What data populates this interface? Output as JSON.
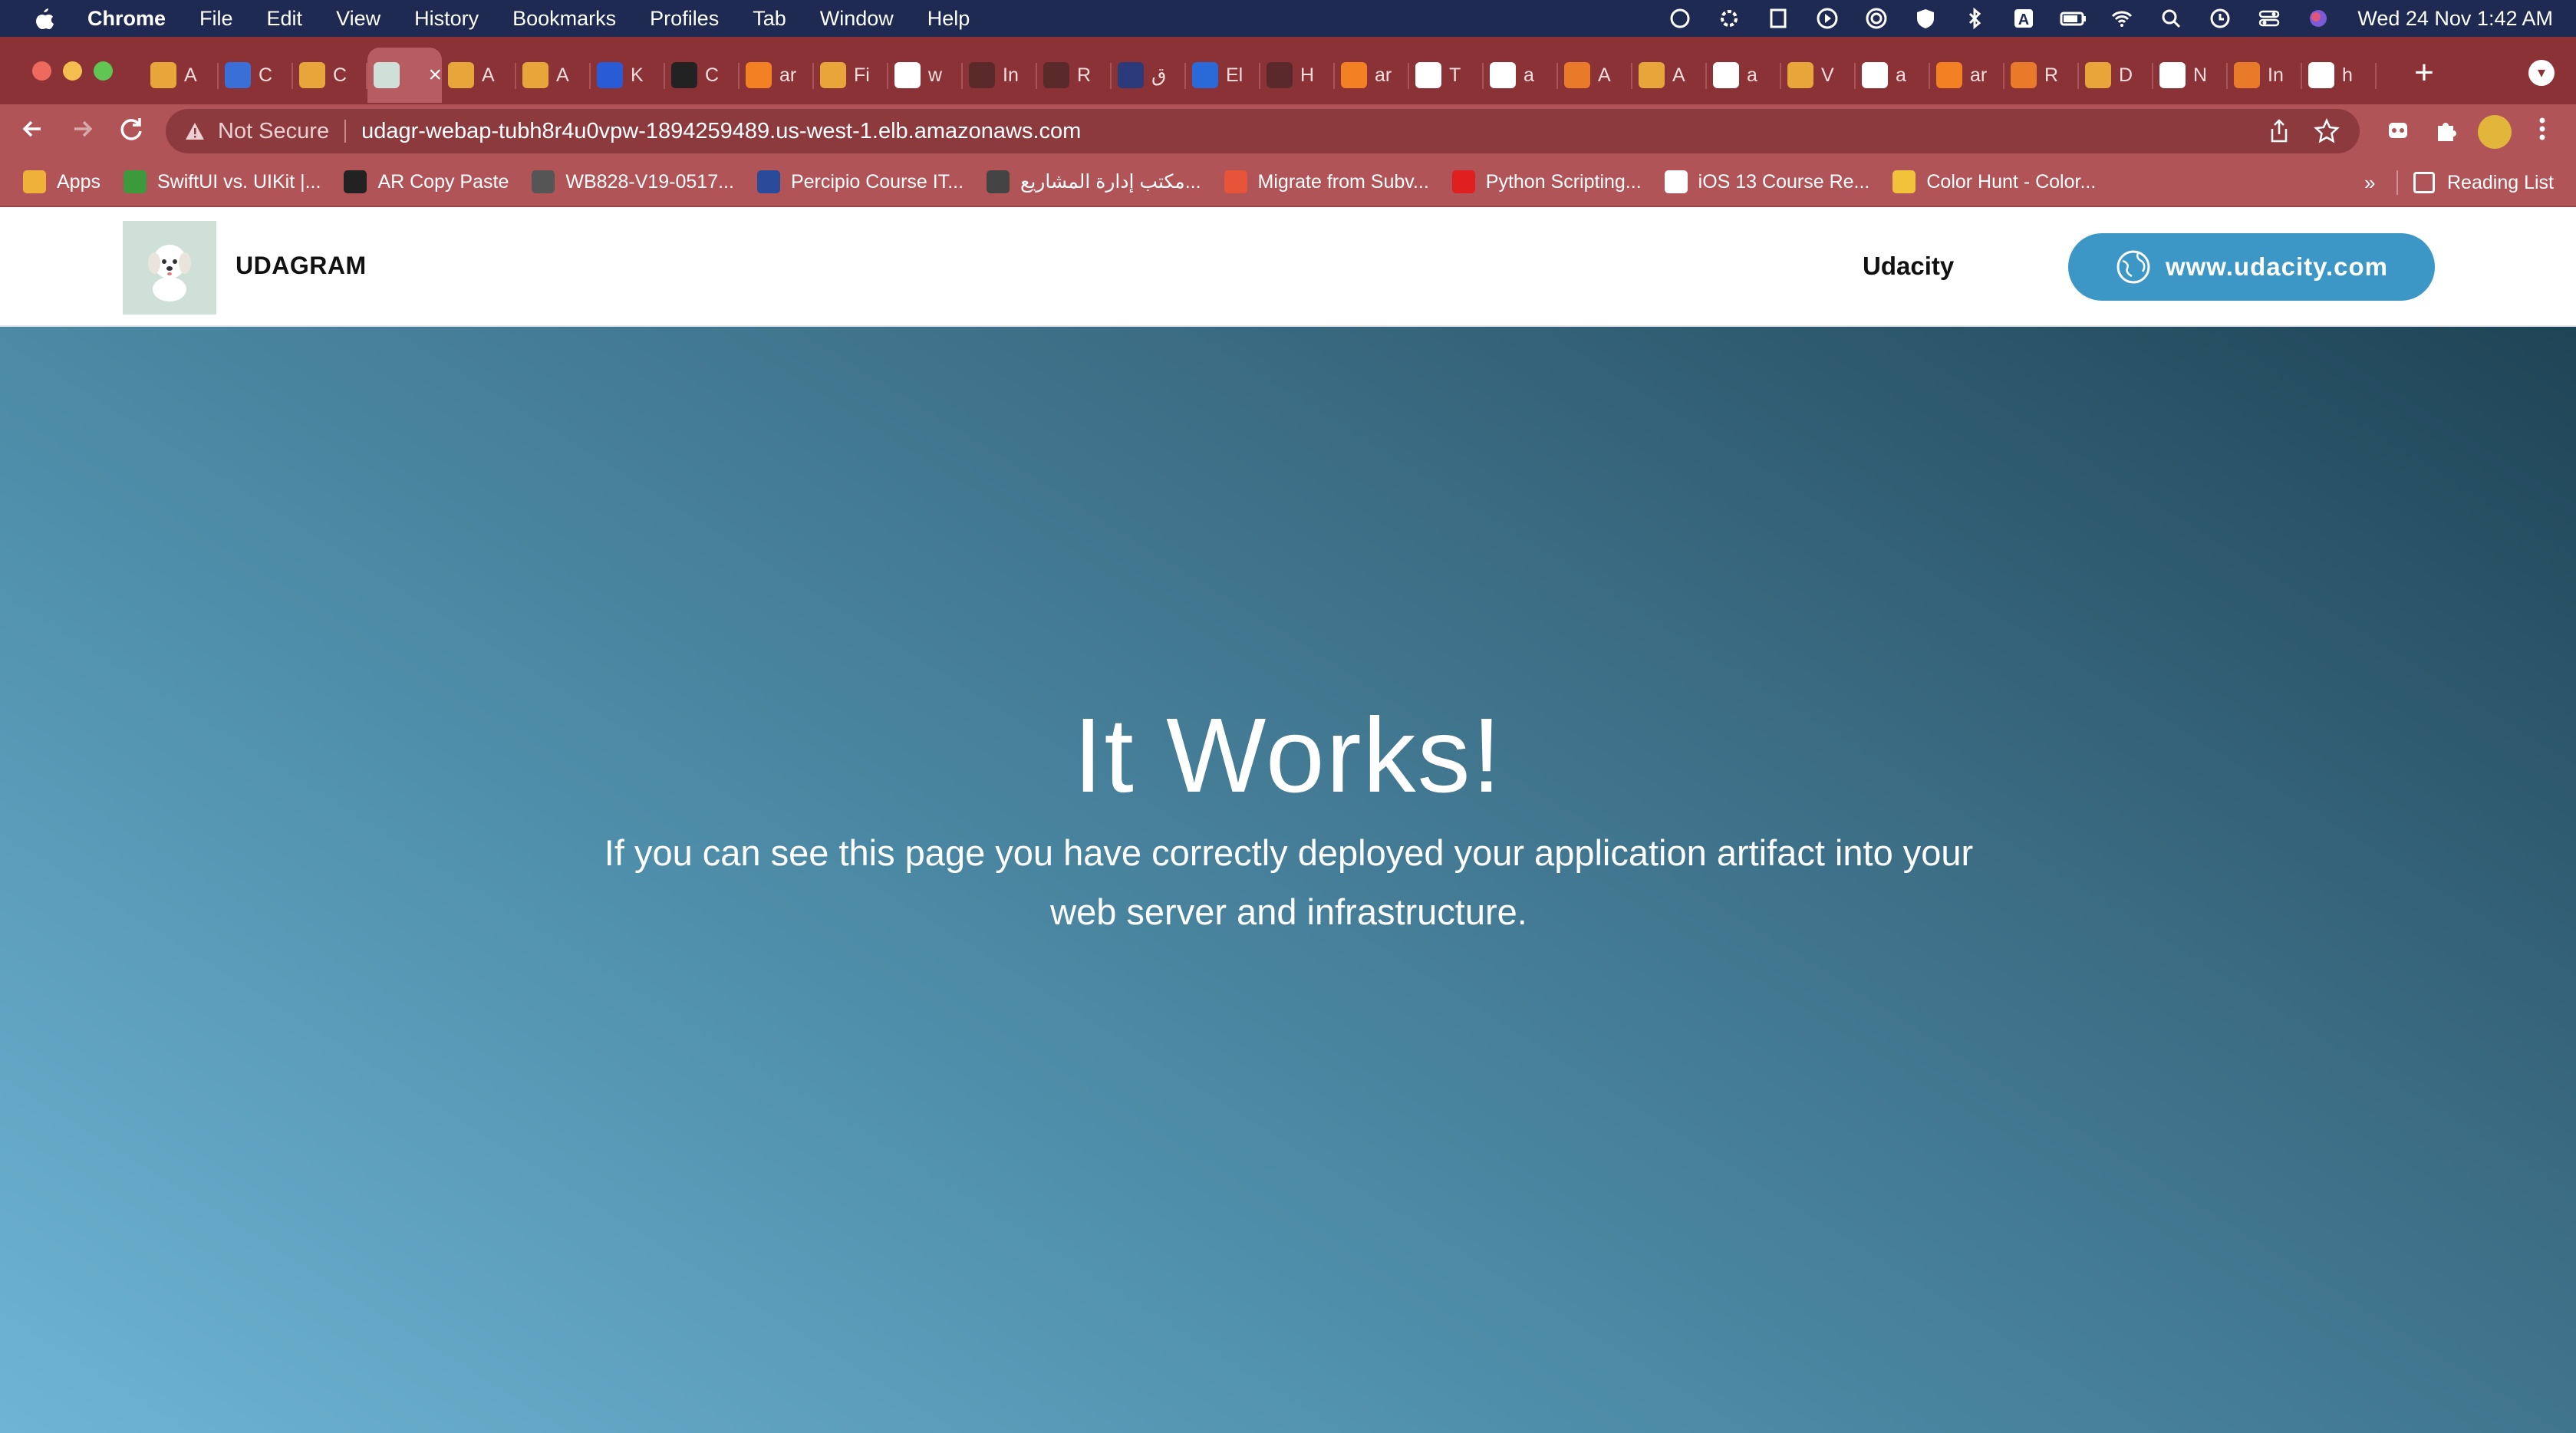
{
  "menubar": {
    "app_name": "Chrome",
    "items": [
      "File",
      "Edit",
      "View",
      "History",
      "Bookmarks",
      "Profiles",
      "Tab",
      "Window",
      "Help"
    ],
    "clock": "Wed 24 Nov  1:42 AM"
  },
  "tabs": [
    {
      "label": "A",
      "color": "#e8a53a"
    },
    {
      "label": "C",
      "color": "#3b6fd8"
    },
    {
      "label": "C",
      "color": "#e8a53a"
    },
    {
      "label": "",
      "color": "#cfe0d9",
      "active": true
    },
    {
      "label": "A",
      "color": "#e8a53a"
    },
    {
      "label": "A",
      "color": "#e8a53a"
    },
    {
      "label": "K",
      "color": "#2a5bd7"
    },
    {
      "label": "C",
      "color": "#222222"
    },
    {
      "label": "ar",
      "color": "#f48024"
    },
    {
      "label": "Fi",
      "color": "#e8a53a"
    },
    {
      "label": "w",
      "color": "#ffffff"
    },
    {
      "label": "In",
      "color": "#5a2a2a"
    },
    {
      "label": "R",
      "color": "#5a2a2a"
    },
    {
      "label": "ق",
      "color": "#2b3a7a"
    },
    {
      "label": "El",
      "color": "#2a6ad8"
    },
    {
      "label": "H",
      "color": "#5a2a2a"
    },
    {
      "label": "ar",
      "color": "#f48024"
    },
    {
      "label": "T",
      "color": "#ffffff"
    },
    {
      "label": "a",
      "color": "#ffffff"
    },
    {
      "label": "A",
      "color": "#e87a2a"
    },
    {
      "label": "A",
      "color": "#e8a53a"
    },
    {
      "label": "a",
      "color": "#ffffff"
    },
    {
      "label": "V",
      "color": "#e8a53a"
    },
    {
      "label": "a",
      "color": "#ffffff"
    },
    {
      "label": "ar",
      "color": "#f48024"
    },
    {
      "label": "R",
      "color": "#e87a2a"
    },
    {
      "label": "D",
      "color": "#e8a53a"
    },
    {
      "label": "N",
      "color": "#ffffff"
    },
    {
      "label": "In",
      "color": "#e87a2a"
    },
    {
      "label": "h",
      "color": "#ffffff"
    }
  ],
  "toolbar": {
    "security_label": "Not Secure",
    "url": "udagr-webap-tubh8r4u0vpw-1894259489.us-west-1.elb.amazonaws.com"
  },
  "bookmarks": [
    {
      "label": "Apps",
      "color": "#f0b13a"
    },
    {
      "label": "SwiftUI vs. UIKit |...",
      "color": "#3c9a3c"
    },
    {
      "label": "AR Copy Paste",
      "color": "#222222"
    },
    {
      "label": "WB828-V19-0517...",
      "color": "#555555"
    },
    {
      "label": "Percipio Course IT...",
      "color": "#2a4a9a"
    },
    {
      "label": "مكتب إدارة المشاريع...",
      "color": "#444444"
    },
    {
      "label": "Migrate from Subv...",
      "color": "#e8543a"
    },
    {
      "label": "Python Scripting...",
      "color": "#e02020"
    },
    {
      "label": "iOS 13 Course Re...",
      "color": "#ffffff"
    },
    {
      "label": "Color Hunt - Color...",
      "color": "#f2c23a"
    }
  ],
  "bookmarks_more": "»",
  "reading_list": "Reading List",
  "site": {
    "brand": "UDAGRAM",
    "nav_link": "Udacity",
    "button_label": "www.udacity.com",
    "accent": "#3c97c7"
  },
  "hero": {
    "title": "It Works!",
    "text": "If you can see this page you have correctly deployed your application artifact into your web server and infrastructure."
  }
}
